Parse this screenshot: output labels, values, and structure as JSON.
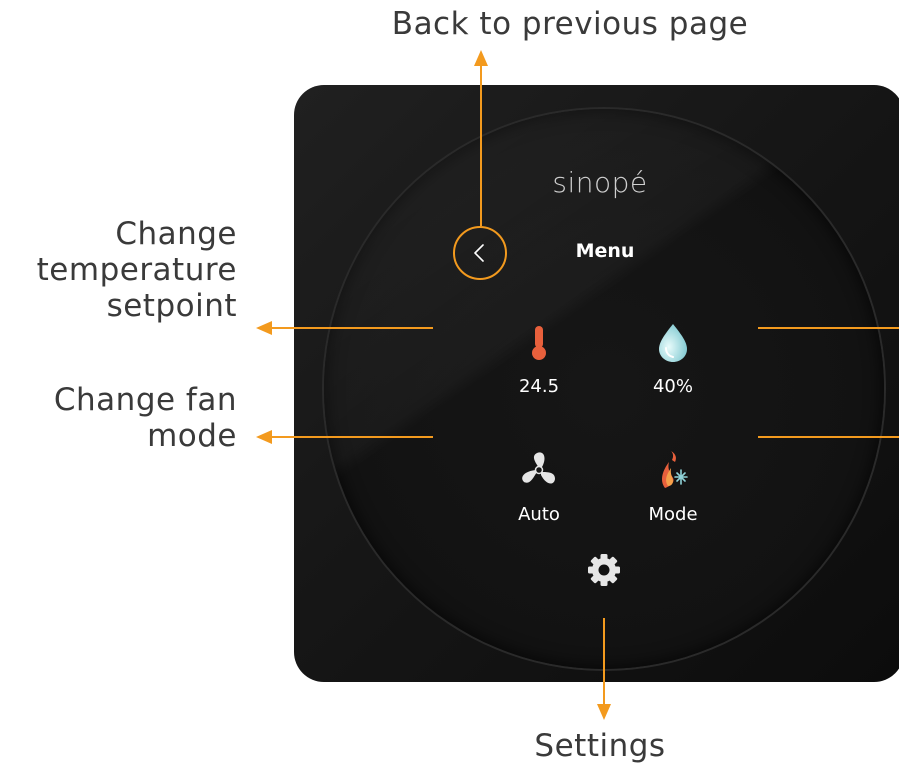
{
  "annotations": {
    "back": "Back to previous page",
    "temperature_line1": "Change",
    "temperature_line2": "temperature",
    "temperature_line3": "setpoint",
    "fan_line1": "Change fan",
    "fan_line2": "mode",
    "settings": "Settings"
  },
  "device": {
    "brand": "sinopé",
    "menu_title": "Menu",
    "tiles": [
      {
        "label": "24.5",
        "icon": "thermometer-icon"
      },
      {
        "label": "40%",
        "icon": "water-drop-icon"
      },
      {
        "label": "Auto",
        "icon": "fan-icon"
      },
      {
        "label": "Mode",
        "icon": "heat-cool-mode-icon"
      }
    ],
    "settings_icon": "gear-icon",
    "back_icon": "chevron-left-icon"
  },
  "colors": {
    "accent": "#f39a1e",
    "device_body": "#161616",
    "thermometer": "#e8603c",
    "water_drop": "#8fd3d8"
  }
}
